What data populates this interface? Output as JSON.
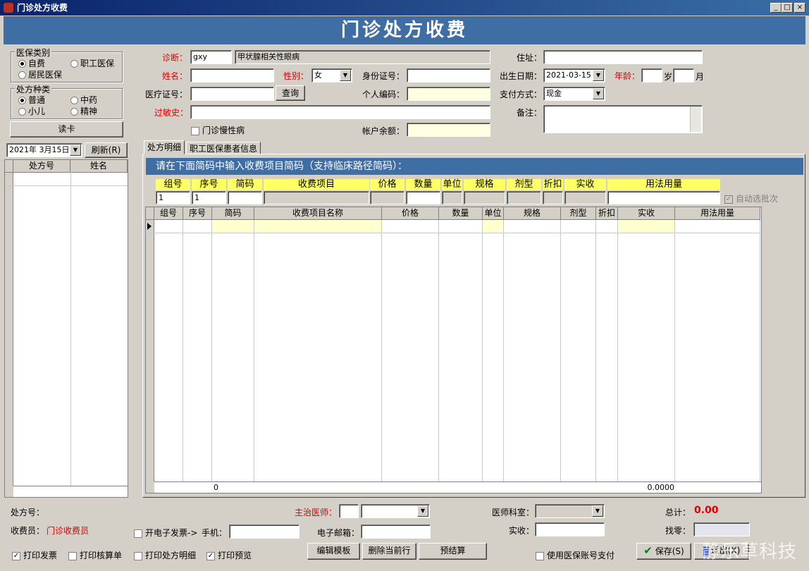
{
  "window": {
    "title": "门诊处方收费",
    "min": "_",
    "max": "□",
    "close": "×"
  },
  "banner": "门诊处方收费",
  "insurance": {
    "legend": "医保类别",
    "options": [
      "自费",
      "职工医保",
      "居民医保"
    ]
  },
  "rxtype": {
    "legend": "处方种类",
    "options": [
      "普通",
      "中药",
      "小儿",
      "精神"
    ]
  },
  "read_card": "读卡",
  "form": {
    "diag_label": "诊断：",
    "diag_code": "gxy",
    "diag_text": "甲状腺相关性眼病",
    "addr_label": "住址：",
    "name_label": "姓名：",
    "sex_label": "性别：",
    "sex_value": "女",
    "id_label": "身份证号：",
    "birth_label": "出生日期：",
    "birth_value": "2021-03-15",
    "age_label": "年龄：",
    "age_unit_year": "岁",
    "age_unit_month": "月",
    "med_label": "医疗证号：",
    "query": "查询",
    "pcode_label": "个人编码：",
    "pay_label": "支付方式：",
    "pay_value": "现金",
    "allergy_label": "过敏史：",
    "note_label": "备注：",
    "chronic_label": "门诊慢性病",
    "balance_label": "帐户余额："
  },
  "left": {
    "date": "2021年  3月15日",
    "refresh": "刷新(R)",
    "cols": [
      "处方号",
      "姓名"
    ]
  },
  "tabs": [
    "处方明细",
    "职工医保患者信息"
  ],
  "hint": "请在下面简码中输入收费项目简码（支持临床路径简码）：",
  "entry": {
    "cols": [
      "组号",
      "序号",
      "简码",
      "收费项目",
      "价格",
      "数量",
      "单位",
      "规格",
      "剂型",
      "折扣",
      "实收",
      "用法用量"
    ],
    "group": "1",
    "seq": "1",
    "auto_batch": "自动选批次"
  },
  "grid": {
    "cols": [
      "组号",
      "序号",
      "简码",
      "收费项目名称",
      "价格",
      "数量",
      "单位",
      "规格",
      "剂型",
      "折扣",
      "实收",
      "用法用量"
    ],
    "foot_count": "0",
    "foot_total": "0.0000"
  },
  "bottom": {
    "rxno_label": "处方号：",
    "cashier_label": "收费员：",
    "cashier_value": "门诊收费员",
    "doctor_label": "主治医师：",
    "dept_label": "医师科室：",
    "total_label": "总计：",
    "total_value": "0.00",
    "einvoice_label": "开电子发票->",
    "phone_label": "手机：",
    "email_label": "电子邮箱：",
    "paid_label": "实收：",
    "change_label": "找零：",
    "print_invoice": "打印发票",
    "print_settle": "打印核算单",
    "print_detail": "打印处方明细",
    "print_preview": "打印预览",
    "edit_tpl": "编辑模板",
    "delete_row": "删除当前行",
    "pre_settle": "预结算",
    "use_account": "使用医保账号支付",
    "save": "保存(S)",
    "exit": "退出(X)"
  },
  "watermark": "静乐草科技"
}
